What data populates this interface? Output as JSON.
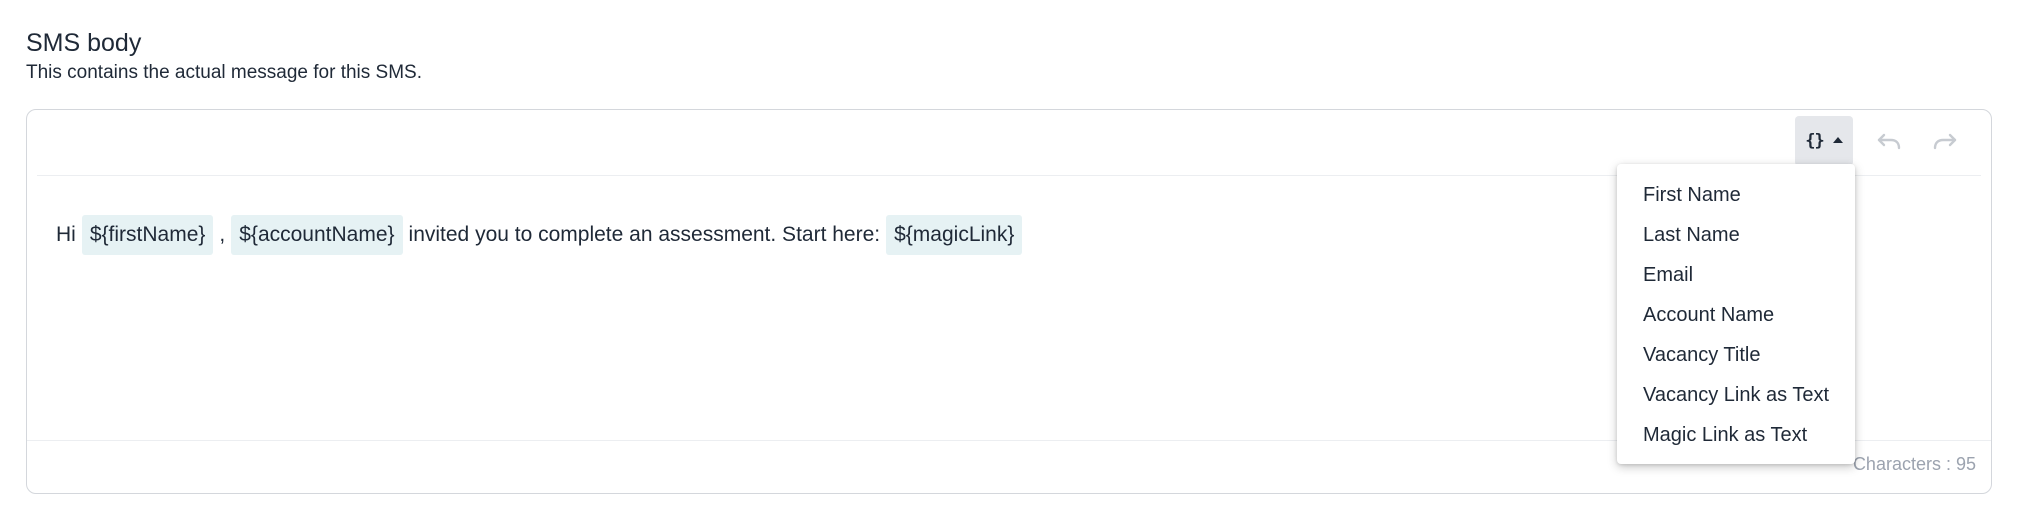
{
  "section": {
    "title": "SMS body",
    "description": "This contains the actual message for this SMS."
  },
  "toolbar": {
    "variables_icon": "{}",
    "variables_icon_name": "braces-icon",
    "undo_icon_name": "undo-icon",
    "redo_icon_name": "redo-icon"
  },
  "message": {
    "parts": [
      {
        "type": "text",
        "value": "Hi"
      },
      {
        "type": "variable",
        "value": "${firstName}"
      },
      {
        "type": "text",
        "value": ","
      },
      {
        "type": "variable",
        "value": "${accountName}"
      },
      {
        "type": "text",
        "value": "invited you to complete an assessment. Start here:"
      },
      {
        "type": "variable",
        "value": "${magicLink}"
      }
    ]
  },
  "variables_menu": {
    "items": [
      "First Name",
      "Last Name",
      "Email",
      "Account Name",
      "Vacancy Title",
      "Vacancy Link as Text",
      "Magic Link as Text"
    ]
  },
  "footer": {
    "char_count_label": "Characters : 95"
  },
  "colors": {
    "chip_background": "#e6f2f4",
    "toolbar_active": "#e5e7eb",
    "muted_text": "#9ca3af"
  }
}
